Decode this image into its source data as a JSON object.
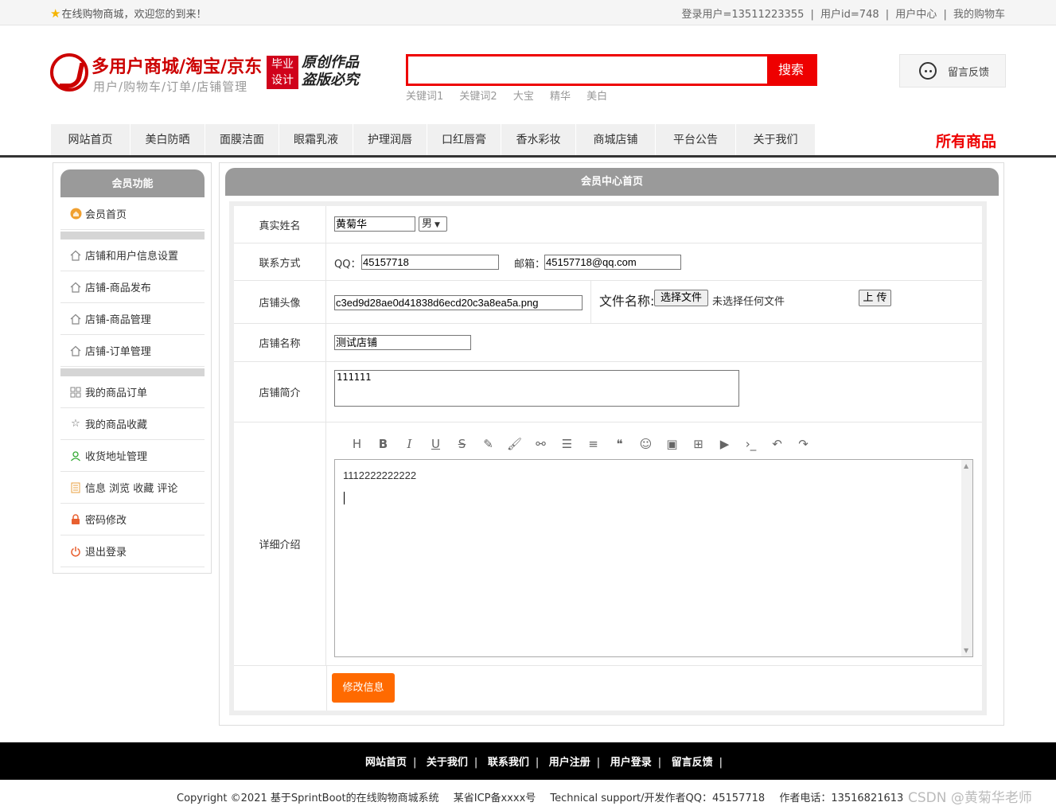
{
  "topbar": {
    "welcome": "在线购物商城，欢迎您的到来！",
    "login_user": "登录用户=13511223355",
    "user_id": "用户id=748",
    "user_center": "用户中心",
    "my_cart": "我的购物车",
    "separator": "|"
  },
  "logo": {
    "title": "多用户商城/淘宝/京东",
    "subtitle": "用户/购物车/订单/店铺管理",
    "badge_line1": "毕业",
    "badge_line2": "设计",
    "slogan_line1": "原创作品",
    "slogan_line2": "盗版必究"
  },
  "search": {
    "placeholder": "",
    "button": "搜索",
    "keywords": [
      "关键词1",
      "关键词2",
      "大宝",
      "精华",
      "美白"
    ]
  },
  "feedback": {
    "label": "留言反馈",
    "icon": "headset-icon"
  },
  "nav": {
    "items": [
      "网站首页",
      "美白防晒",
      "面膜洁面",
      "眼霜乳液",
      "护理润唇",
      "口红唇膏",
      "香水彩妆",
      "商城店铺",
      "平台公告",
      "关于我们"
    ],
    "all_products": "所有商品"
  },
  "sidebar": {
    "title": "会员功能",
    "items": [
      {
        "label": "会员首页",
        "icon": "home-orange-icon"
      },
      {
        "label": "店铺和用户信息设置",
        "icon": "house-icon"
      },
      {
        "label": "店铺-商品发布",
        "icon": "house-icon"
      },
      {
        "label": "店铺-商品管理",
        "icon": "house-icon"
      },
      {
        "label": "店铺-订单管理",
        "icon": "house-icon"
      },
      {
        "label": "我的商品订单",
        "icon": "grid-icon"
      },
      {
        "label": "我的商品收藏",
        "icon": "star-icon"
      },
      {
        "label": "收货地址管理",
        "icon": "person-icon"
      },
      {
        "label": "信息 浏览 收藏 评论",
        "icon": "document-icon"
      },
      {
        "label": "密码修改",
        "icon": "lock-icon"
      },
      {
        "label": "退出登录",
        "icon": "power-icon"
      }
    ]
  },
  "main": {
    "title": "会员中心首页",
    "form": {
      "real_name_label": "真实姓名",
      "real_name": "黄菊华",
      "gender": "男",
      "contact_label": "联系方式",
      "qq_label": "QQ：",
      "qq": "45157718",
      "email_label": "邮箱：",
      "email": "45157718@qq.com",
      "avatar_label": "店铺头像",
      "avatar_file": "c3ed9d28ae0d41838d6ecd20c3a8ea5a.png",
      "file_name_label": "文件名称:",
      "choose_file": "选择文件",
      "no_file": "未选择任何文件",
      "upload": "上 传",
      "shop_name_label": "店铺名称",
      "shop_name": "测试店铺",
      "shop_intro_label": "店铺简介",
      "shop_intro": "111111",
      "detail_label": "详细介绍",
      "detail_content": "1112222222222",
      "submit": "修改信息"
    },
    "toolbar": [
      "heading-icon",
      "bold-icon",
      "italic-icon",
      "underline-icon",
      "strikethrough-icon",
      "marker-icon",
      "brush-icon",
      "link-icon",
      "bullet-list-icon",
      "align-icon",
      "quote-icon",
      "emoji-icon",
      "image-icon",
      "table-icon",
      "video-icon",
      "code-icon",
      "undo-icon",
      "redo-icon"
    ]
  },
  "footer": {
    "links": [
      "网站首页",
      "关于我们",
      "联系我们",
      "用户注册",
      "用户登录",
      "留言反馈"
    ],
    "separator": "|",
    "copyright": "Copyright ©2021 基于SprintBoot的在线购物商城系统",
    "icp": "某省ICP备xxxx号",
    "support": "Technical support/开发作者QQ：45157718",
    "phone": "作者电话：13516821613"
  },
  "watermark": "CSDN @黄菊华老师",
  "colors": {
    "brand_red": "#e00000",
    "submit_orange": "#ff6a00",
    "header_gray": "#9a9a9a"
  }
}
